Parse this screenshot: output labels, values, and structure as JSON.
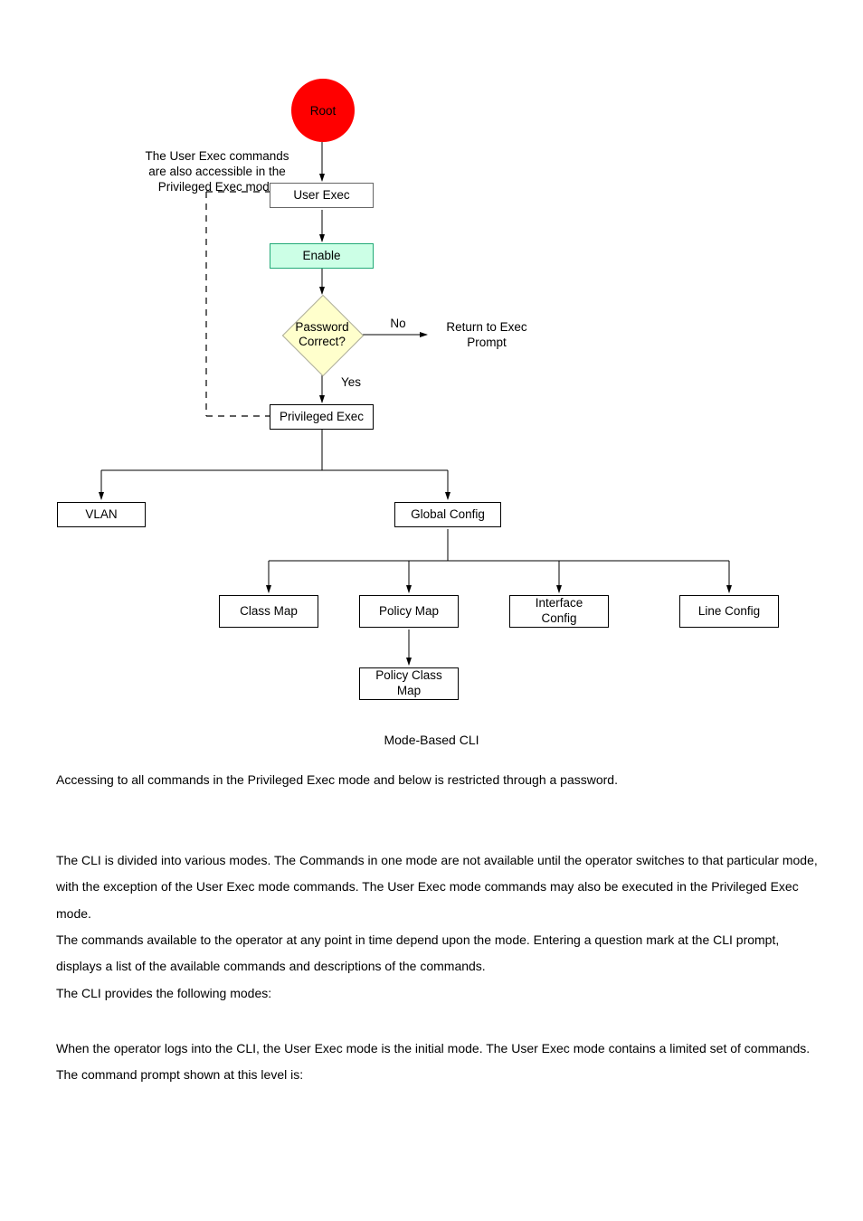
{
  "diagram": {
    "root": "Root",
    "user_exec": "User Exec",
    "enable": "Enable",
    "password_q": "Password\nCorrect?",
    "no": "No",
    "return_exec": "Return to Exec\nPrompt",
    "yes": "Yes",
    "privileged_exec": "Privileged Exec",
    "vlan": "VLAN",
    "global_config": "Global Config",
    "class_map": "Class Map",
    "policy_map": "Policy Map",
    "interface_config": "Interface\nConfig",
    "line_config": "Line Config",
    "policy_class_map": "Policy Class\nMap",
    "note": "The User Exec commands\nare also accessible in the\nPrivileged Exec mode",
    "caption": "Mode-Based CLI"
  },
  "text": {
    "p1": "Accessing to all commands in the Privileged Exec mode and below is restricted through a password.",
    "p2": "The CLI is divided into various modes. The Commands in one mode are not available until the operator switches to that particular mode, with the exception of the User Exec mode commands. The User Exec mode commands may also be executed in the Privileged Exec mode.",
    "p3": "The commands available to the operator at any point in time depend upon the mode. Entering a question mark       at the CLI prompt, displays a list of the available commands and descriptions of the commands.",
    "p4": "The CLI provides the following modes:",
    "p5": "When the operator logs into the CLI, the User Exec mode is the initial mode. The User Exec mode contains a limited set of commands. The command prompt shown at this level is:"
  }
}
